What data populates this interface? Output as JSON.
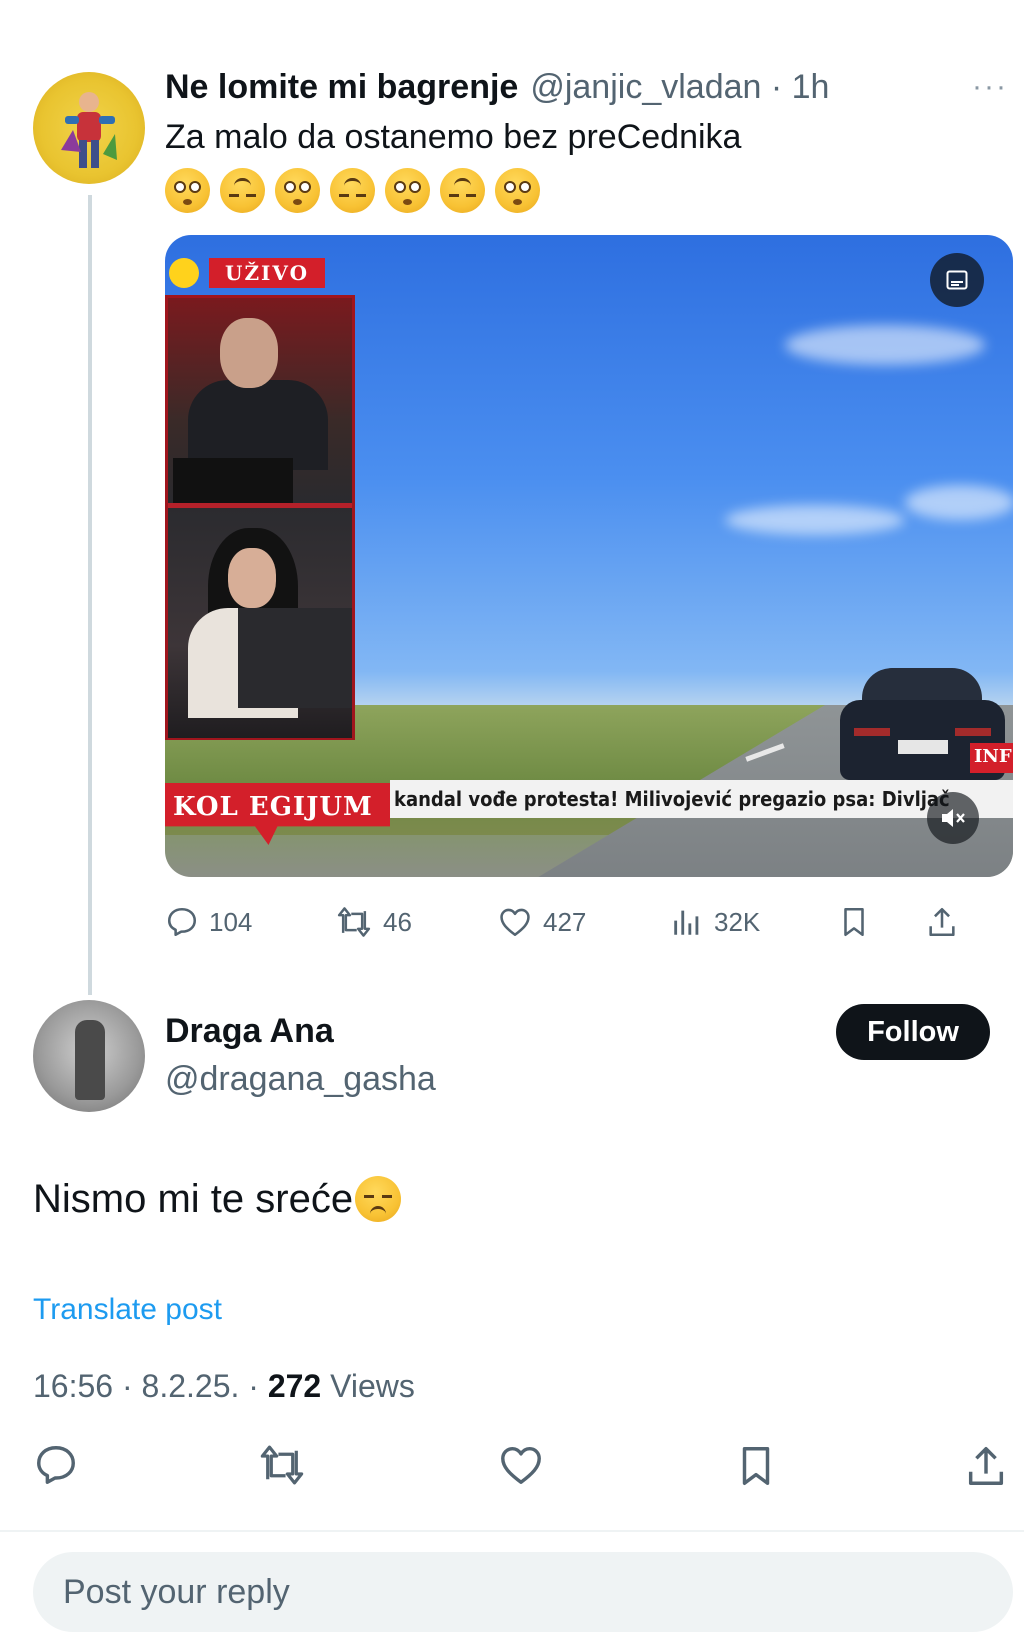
{
  "parent_post": {
    "author_name": "Ne lomite mi bagrenje",
    "handle_time": "@janjic_vladan · 1h",
    "more_label": "···",
    "text": "Za malo da ostanemo bez preCednika",
    "emojis": [
      "flushed-face",
      "upside-down-face",
      "flushed-face",
      "upside-down-face",
      "flushed-face",
      "upside-down-face",
      "flushed-face"
    ],
    "video": {
      "live_label": "UŽIVO",
      "banner_label": "KOL EGIJUM",
      "ticker_text": "kandal vođe protesta! Milivojević pregazio psa: Divljač",
      "corner_tag": "INF"
    },
    "stats": {
      "replies": "104",
      "reposts": "46",
      "likes": "427",
      "views": "32K"
    }
  },
  "reply_post": {
    "author_name": "Draga Ana",
    "handle": "@dragana_gasha",
    "follow_label": "Follow",
    "text": "Nismo mi te sreće",
    "text_emoji": "disappointed-face",
    "translate_label": "Translate post",
    "time": "16:56 · 8.2.25. · ",
    "views_count": "272",
    "views_label": " Views"
  },
  "composer": {
    "placeholder": "Post your reply"
  },
  "colors": {
    "accent": "#1d9bf0",
    "text": "#0f1419",
    "muted": "#536471",
    "live_red": "#d31f2a"
  }
}
